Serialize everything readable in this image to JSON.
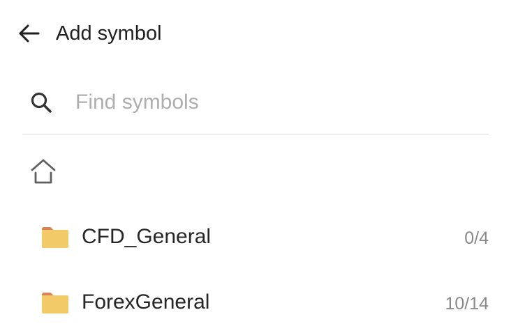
{
  "header": {
    "title": "Add symbol",
    "back_icon": "arrow-left-icon"
  },
  "search": {
    "placeholder": "Find symbols",
    "value": "",
    "icon": "search-icon"
  },
  "breadcrumb": {
    "home_icon": "home-icon"
  },
  "folders": [
    {
      "name": "CFD_General",
      "count": "0/4",
      "icon": "folder-icon"
    },
    {
      "name": "ForexGeneral",
      "count": "10/14",
      "icon": "folder-icon"
    }
  ],
  "colors": {
    "folder": "#f3ca68",
    "folder_tab": "#d9825e",
    "text": "#1f1f1f",
    "muted": "#8a8a8a",
    "placeholder": "#aeaeae",
    "divider": "#d9d9d9"
  }
}
